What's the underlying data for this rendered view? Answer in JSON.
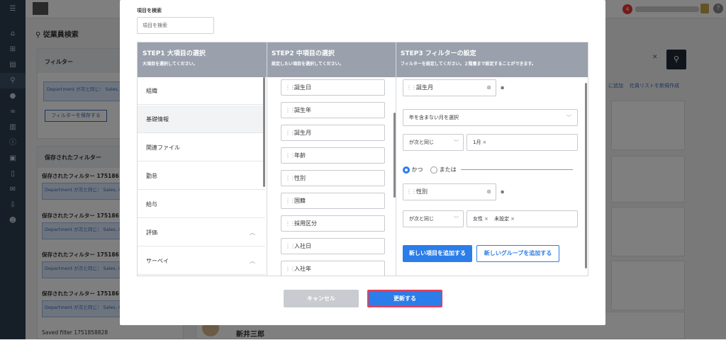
{
  "background": {
    "page_title": "従業員検索",
    "filter_panel_title": "フィルター",
    "filter_chip_text": "Department が次と同じ： Sales, IT, Finance",
    "save_filter_button": "フィルターを保存する",
    "saved_filters_title": "保存されたフィルター",
    "saved_filters": [
      {
        "name": "保存されたフィルター 175186",
        "chip": "Department が次と同じ： Sales, IT, Finance"
      },
      {
        "name": "保存されたフィルター 175186",
        "chip": "Department が次と同じ： Sales, IT, Finance"
      },
      {
        "name": "保存されたフィルター 175186",
        "chip": "Department が次と同じ： Sales, IT, Finance"
      },
      {
        "name": "保存されたフィルター 175186",
        "chip": "Department が次と同じ： Sales, IT, Finance"
      }
    ],
    "saved_filter_footer": "Saved filter 1751858828",
    "link_add": "に追加",
    "link_create_list": "社員リストを新規作成",
    "employee_name": "新井三郎",
    "notification_count": "4"
  },
  "modal": {
    "search_label": "項目を検索",
    "search_placeholder": "項目を検索",
    "step1": {
      "title": "STEP1 大項目の選択",
      "subtitle": "大項目を選択してください。",
      "items": [
        "組織",
        "基礎情報",
        "関連ファイル",
        "勤怠",
        "給与",
        "評価",
        "サーベイ"
      ]
    },
    "step2": {
      "title": "STEP2 中項目の選択",
      "subtitle": "設定したい項目を選択してください。",
      "items": [
        "誕生日",
        "誕生年",
        "誕生月",
        "年齢",
        "性別",
        "国籍",
        "採用区分",
        "入社日",
        "入社年"
      ]
    },
    "step3": {
      "title": "STEP3 フィルターの設定",
      "subtitle": "フィルターを設定してください。２階層まで設定することができます。",
      "filter1_field": "誕生月",
      "filter1_option": "年を含まない月を選択",
      "filter1_operator": "が次と同じ",
      "filter1_value": "1月",
      "logic_and": "かつ",
      "logic_or": "または",
      "filter2_field": "性別",
      "filter2_operator": "が次と同じ",
      "filter2_values": [
        "女性",
        "未設定"
      ],
      "add_item_button": "新しい項目を追加する",
      "add_group_button": "新しいグループを追加する"
    },
    "cancel_button": "キャンセル",
    "update_button": "更新する"
  }
}
